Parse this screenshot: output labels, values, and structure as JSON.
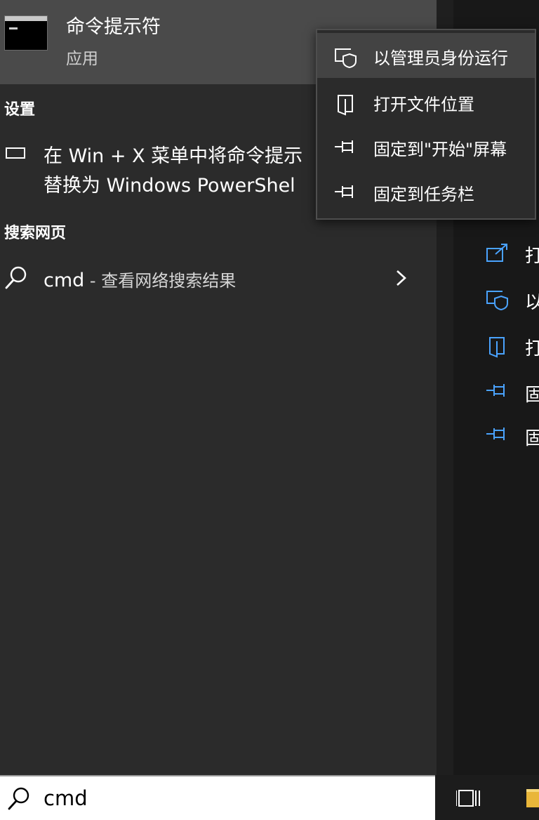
{
  "best_match": {
    "title": "命令提示符",
    "subtitle": "应用",
    "icon": "command-prompt-icon"
  },
  "sections": {
    "settings_label": "设置",
    "web_label": "搜索网页"
  },
  "settings_result": {
    "line1": "在 Win + X 菜单中将命令提示",
    "line2": "替换为 Windows PowerShel",
    "icon": "display-icon"
  },
  "web_result": {
    "query": "cmd",
    "suffix": " - 查看网络搜索结果",
    "icon": "search-icon",
    "chevron_icon": "chevron-right-icon"
  },
  "context_menu": {
    "items": [
      {
        "label": "以管理员身份运行",
        "icon": "shield-window-icon",
        "active": true
      },
      {
        "label": "打开文件位置",
        "icon": "open-file-location-icon",
        "active": false
      },
      {
        "label": "固定到\"开始\"屏幕",
        "icon": "pin-icon",
        "active": false
      },
      {
        "label": "固定到任务栏",
        "icon": "pin-icon",
        "active": false
      }
    ]
  },
  "right_actions": [
    {
      "label": "打",
      "icon": "open-icon"
    },
    {
      "label": "以",
      "icon": "shield-window-icon"
    },
    {
      "label": "打",
      "icon": "open-file-location-icon"
    },
    {
      "label": "固",
      "icon": "pin-icon"
    },
    {
      "label": "固",
      "icon": "pin-icon"
    }
  ],
  "search_bar": {
    "value": "cmd",
    "icon": "search-icon"
  },
  "taskbar": {
    "task_view_icon": "task-view-icon",
    "folder_icon": "file-explorer-icon"
  },
  "colors": {
    "panel": "#2b2b2b",
    "best_match_highlight": "#4a4a4a",
    "menu_active": "#434343",
    "accent_icon": "#4aa3ff"
  }
}
